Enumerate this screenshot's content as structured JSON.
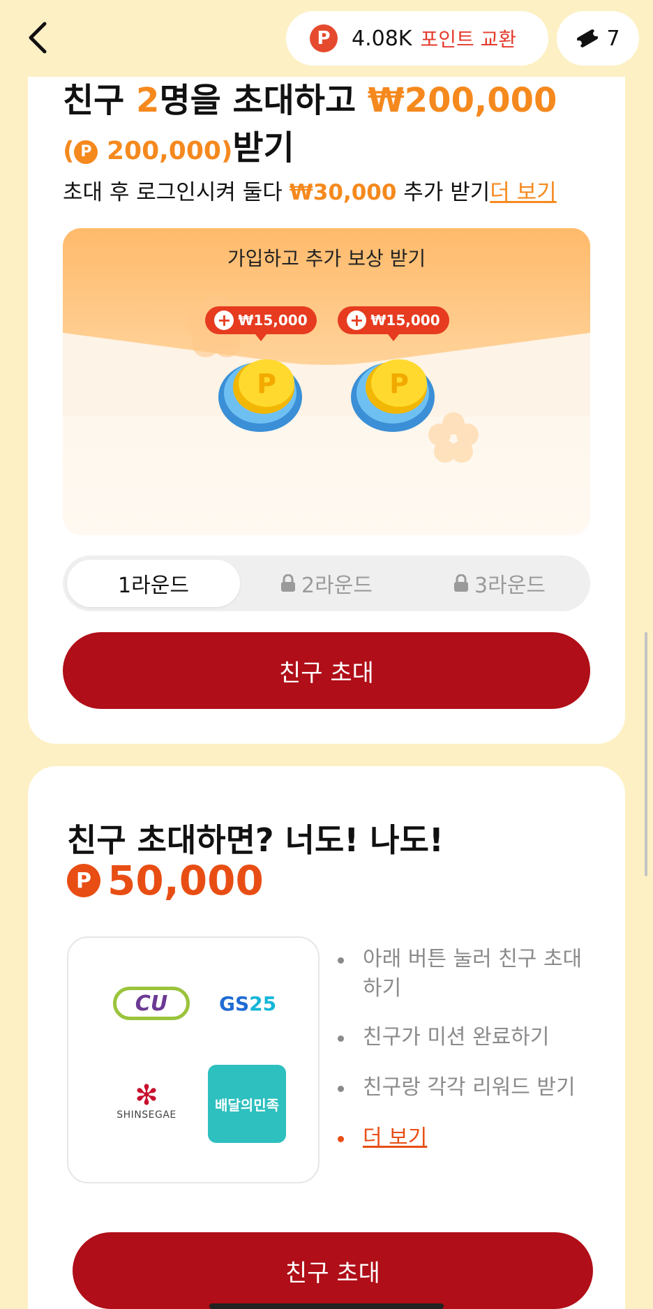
{
  "header": {
    "points_badge": "P",
    "points_value": "4.08K",
    "points_exchange": "포인트 교환",
    "tickets_count": "7"
  },
  "invite_card": {
    "title_part1": "친구 ",
    "title_count": "2",
    "title_part2": "명을 초대하고 ",
    "title_amount": "₩200,000",
    "title_points_open": "(",
    "title_points_badge": "P",
    "title_points": " 200,000)",
    "title_suffix": "받기",
    "subline_prefix": "초대 후 로그인시켜 둘다 ",
    "subline_amount": "₩30,000",
    "subline_suffix": " 추가 받기",
    "subline_link": "더 보기",
    "reward_title": "가입하고 추가 보상 받기",
    "coins": [
      {
        "tag": "₩15,000"
      },
      {
        "tag": "₩15,000"
      }
    ],
    "rounds": [
      {
        "label": "1라운드",
        "active": true,
        "locked": false
      },
      {
        "label": "2라운드",
        "active": false,
        "locked": true
      },
      {
        "label": "3라운드",
        "active": false,
        "locked": true
      }
    ],
    "button_label": "친구 초대"
  },
  "benefit_card": {
    "title": "친구 초대하면? 너도! 나도!",
    "amount_badge": "P",
    "amount": "50,000",
    "brands": {
      "cu": "CU",
      "gs_main": "GS",
      "gs_num": "25",
      "shinsegae": "SHINSEGAE",
      "baemin": "배달의민족"
    },
    "steps": [
      "아래 버튼 눌러 친구 초대하기",
      "친구가 미션 완료하기",
      "친구랑 각각 리워드 받기"
    ],
    "more_link": "더 보기",
    "button_label": "친구 초대"
  },
  "colors": {
    "accent_orange": "#f5891e",
    "primary_red": "#b00e18",
    "background": "#fdf0c4"
  }
}
